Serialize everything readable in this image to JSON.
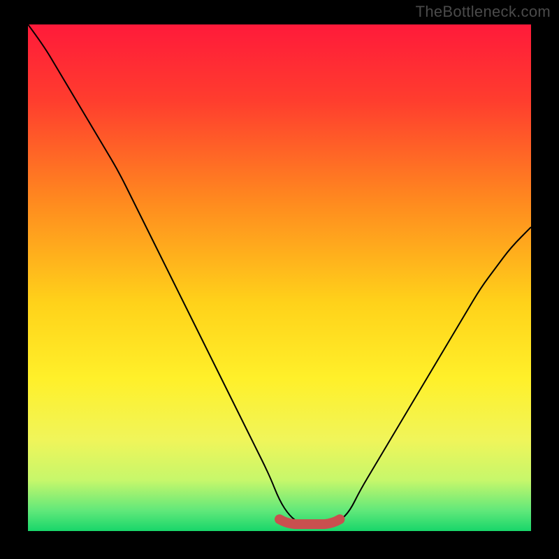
{
  "watermark": "TheBottleneck.com",
  "chart_data": {
    "type": "line",
    "title": "",
    "xlabel": "",
    "ylabel": "",
    "xlim": [
      0,
      100
    ],
    "ylim": [
      0,
      100
    ],
    "x": [
      0,
      3,
      6,
      9,
      12,
      15,
      18,
      21,
      24,
      27,
      30,
      33,
      36,
      39,
      42,
      45,
      48,
      50,
      52,
      54,
      56,
      58,
      60,
      62,
      64,
      66,
      69,
      72,
      75,
      78,
      81,
      84,
      87,
      90,
      93,
      96,
      100
    ],
    "values": [
      100,
      96,
      91,
      86,
      81,
      76,
      71,
      65,
      59,
      53,
      47,
      41,
      35,
      29,
      23,
      17,
      11,
      6,
      3,
      1.5,
      1,
      1,
      1.2,
      2,
      4,
      8,
      13,
      18,
      23,
      28,
      33,
      38,
      43,
      48,
      52,
      56,
      60
    ],
    "gradient_stops": [
      {
        "offset": 0,
        "color": "#ff1a3a"
      },
      {
        "offset": 0.15,
        "color": "#ff3d2e"
      },
      {
        "offset": 0.35,
        "color": "#ff8a1f"
      },
      {
        "offset": 0.55,
        "color": "#ffd21a"
      },
      {
        "offset": 0.7,
        "color": "#fff02a"
      },
      {
        "offset": 0.82,
        "color": "#f0f55a"
      },
      {
        "offset": 0.9,
        "color": "#c6f76b"
      },
      {
        "offset": 0.96,
        "color": "#60e87a"
      },
      {
        "offset": 1.0,
        "color": "#18d66a"
      }
    ],
    "highlight_band": {
      "x_start": 50,
      "x_end": 62,
      "y": 1.5,
      "color": "#c9504f",
      "thickness": 14
    }
  }
}
